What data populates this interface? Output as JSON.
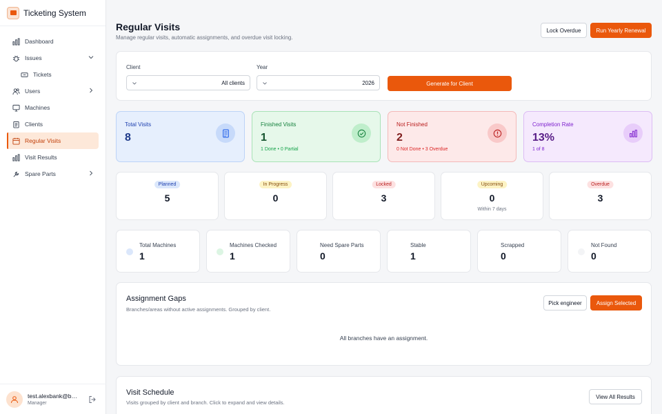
{
  "app": {
    "title": "Ticketing System"
  },
  "sidebar": {
    "items": [
      {
        "label": "Dashboard",
        "icon": "bar-chart-icon"
      },
      {
        "label": "Issues",
        "icon": "bug-icon",
        "expanded": true
      },
      {
        "label": "Tickets",
        "icon": "ticket-icon",
        "sub": true
      },
      {
        "label": "Users",
        "icon": "users-icon"
      },
      {
        "label": "Machines",
        "icon": "monitor-icon"
      },
      {
        "label": "Clients",
        "icon": "clipboard-icon"
      },
      {
        "label": "Regular Visits",
        "icon": "calendar-icon",
        "active": true
      },
      {
        "label": "Visit Results",
        "icon": "bar-chart-icon"
      },
      {
        "label": "Spare Parts",
        "icon": "wrench-icon"
      }
    ],
    "user": {
      "email": "test.alexbank@bi...",
      "role": "Manager"
    }
  },
  "header": {
    "title": "Regular Visits",
    "subtitle": "Manage regular visits, automatic assignments, and overdue visit locking.",
    "lock_label": "Lock Overdue",
    "renewal_label": "Run Yearly Renewal"
  },
  "filters": {
    "client_label": "Client",
    "client_value": "All clients",
    "year_label": "Year",
    "year_value": "2026",
    "generate_label": "Generate for Client"
  },
  "stats": [
    {
      "label": "Total Visits",
      "value": "8",
      "sub": "",
      "icon": "document-icon"
    },
    {
      "label": "Finished Visits",
      "value": "1",
      "sub": "1 Done • 0 Partial",
      "icon": "check-circle-icon"
    },
    {
      "label": "Not Finished",
      "value": "2",
      "sub": "0 Not Done • 3 Overdue",
      "icon": "alert-circle-icon"
    },
    {
      "label": "Completion Rate",
      "value": "13%",
      "sub": "1 of 8",
      "icon": "bar-chart-icon"
    }
  ],
  "statuses": [
    {
      "label": "Planned",
      "value": "5",
      "sub": ""
    },
    {
      "label": "In Progress",
      "value": "0",
      "sub": ""
    },
    {
      "label": "Locked",
      "value": "3",
      "sub": ""
    },
    {
      "label": "Upcoming",
      "value": "0",
      "sub": "Within 7 days"
    },
    {
      "label": "Overdue",
      "value": "3",
      "sub": ""
    }
  ],
  "machines": [
    {
      "label": "Total Machines",
      "value": "1"
    },
    {
      "label": "Machines Checked",
      "value": "1"
    },
    {
      "label": "Need Spare Parts",
      "value": "0"
    },
    {
      "label": "Stable",
      "value": "1"
    },
    {
      "label": "Scrapped",
      "value": "0"
    },
    {
      "label": "Not Found",
      "value": "0"
    }
  ],
  "gaps": {
    "title": "Assignment Gaps",
    "subtitle": "Branches/areas without active assignments. Grouped by client.",
    "pick_label": "Pick engineer",
    "assign_label": "Assign Selected",
    "empty": "All branches have an assignment."
  },
  "schedule": {
    "title": "Visit Schedule",
    "subtitle": "Visits grouped by client and branch. Click to expand and view details.",
    "view_all_label": "View All Results"
  },
  "colors": {
    "accent": "#ea580c",
    "blue": "#2563eb",
    "green": "#16a34a",
    "red": "#dc2626",
    "purple": "#7e22ce"
  }
}
